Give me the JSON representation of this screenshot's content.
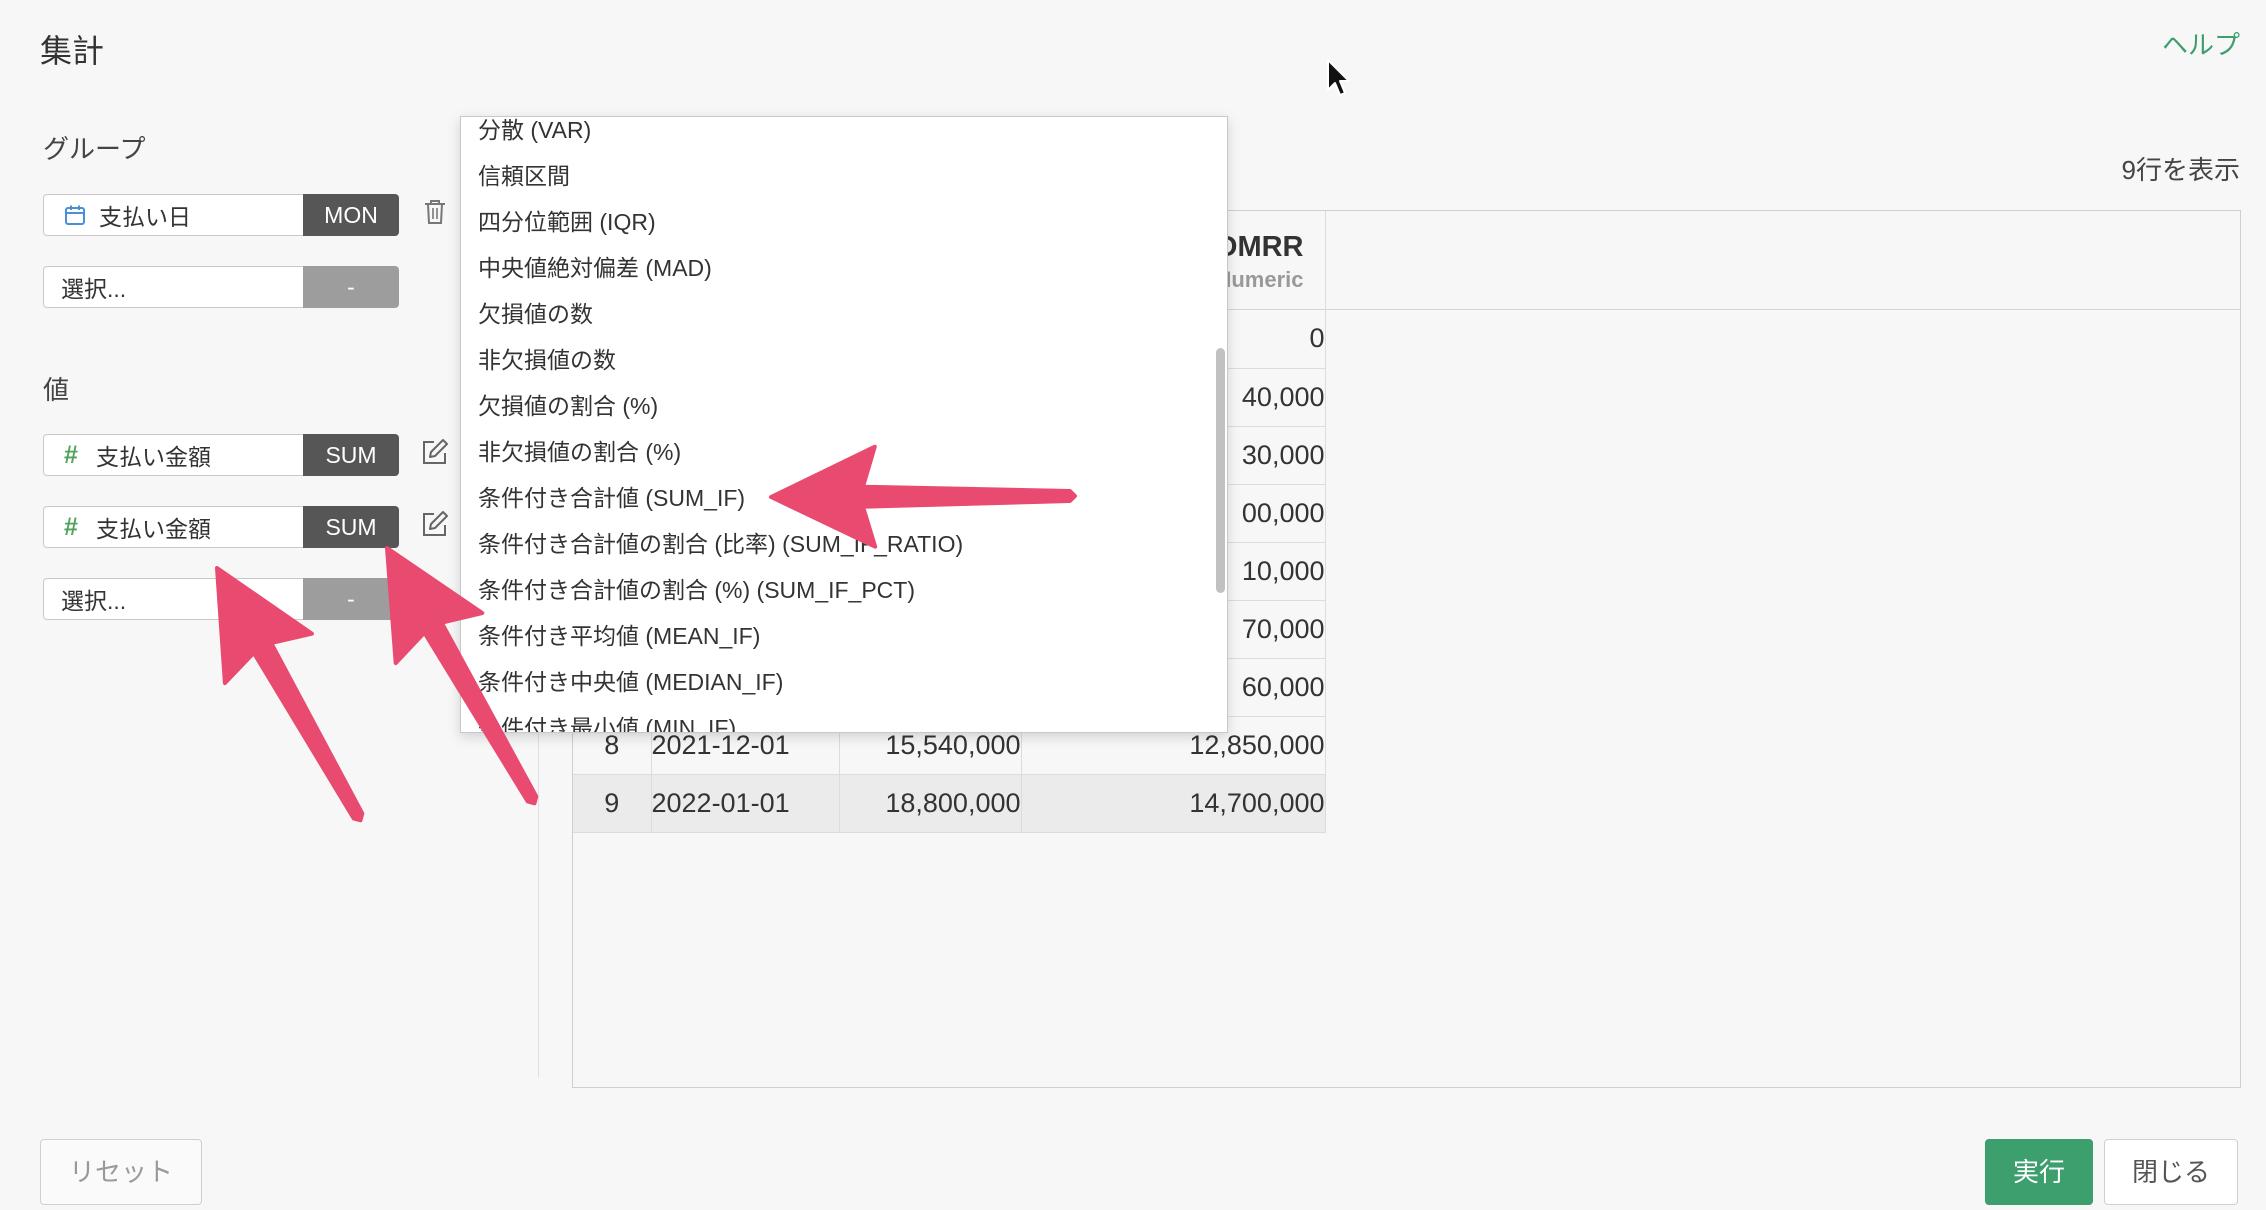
{
  "dialog": {
    "title": "集計",
    "help_label": "ヘルプ"
  },
  "group": {
    "label": "グループ",
    "rows": [
      {
        "icon": "calendar-icon",
        "column": "支払い日",
        "function": "MON"
      },
      {
        "column": "選択...",
        "function": "-"
      }
    ],
    "remove_icon": "trash-icon"
  },
  "values": {
    "label": "値",
    "rows": [
      {
        "icon": "hash-icon",
        "column": "支払い金額",
        "function": "SUM"
      },
      {
        "icon": "hash-icon",
        "column": "支払い金額",
        "function": "SUM"
      },
      {
        "column": "選択...",
        "function": "-"
      }
    ],
    "edit_icon": "edit-icon"
  },
  "preview": {
    "row_count_label": "9行を表示",
    "columns": [
      {
        "name": "",
        "type": ""
      },
      {
        "name": "",
        "type": ""
      },
      {
        "name": "",
        "type": ""
      },
      {
        "name": "DMRR",
        "type": "Numeric"
      }
    ],
    "rows": [
      [
        "",
        "",
        "",
        "0"
      ],
      [
        "",
        "",
        "",
        "40,000"
      ],
      [
        "",
        "",
        "",
        "30,000"
      ],
      [
        "",
        "",
        "",
        "00,000"
      ],
      [
        "",
        "",
        "",
        "10,000"
      ],
      [
        "",
        "",
        "",
        "70,000"
      ],
      [
        "",
        "",
        "",
        "60,000"
      ],
      [
        "8",
        "2021-12-01",
        "15,540,000",
        "12,850,000"
      ],
      [
        "9",
        "2022-01-01",
        "18,800,000",
        "14,700,000"
      ]
    ],
    "highlighted_row": 9
  },
  "function_menu": {
    "items": [
      "分散 (VAR)",
      "信頼区間",
      "四分位範囲 (IQR)",
      "中央値絶対偏差 (MAD)",
      "欠損値の数",
      "非欠損値の数",
      "欠損値の割合 (%)",
      "非欠損値の割合 (%)",
      "条件付き合計値 (SUM_IF)",
      "条件付き合計値の割合 (比率) (SUM_IF_RATIO)",
      "条件付き合計値の割合 (%) (SUM_IF_PCT)",
      "条件付き平均値 (MEAN_IF)",
      "条件付き中央値 (MEDIAN_IF)",
      "条件付き最小値 (MIN_IF)"
    ]
  },
  "footer": {
    "reset_label": "リセット",
    "run_label": "実行",
    "close_label": "閉じる"
  },
  "theme": {
    "accent": "#3d9e6e",
    "annotation": "#e94a6f",
    "function_button": "#565656",
    "function_button_empty": "#9d9d9d",
    "date_icon": "#4a8fd8",
    "numeric_icon": "#4fa35a"
  }
}
